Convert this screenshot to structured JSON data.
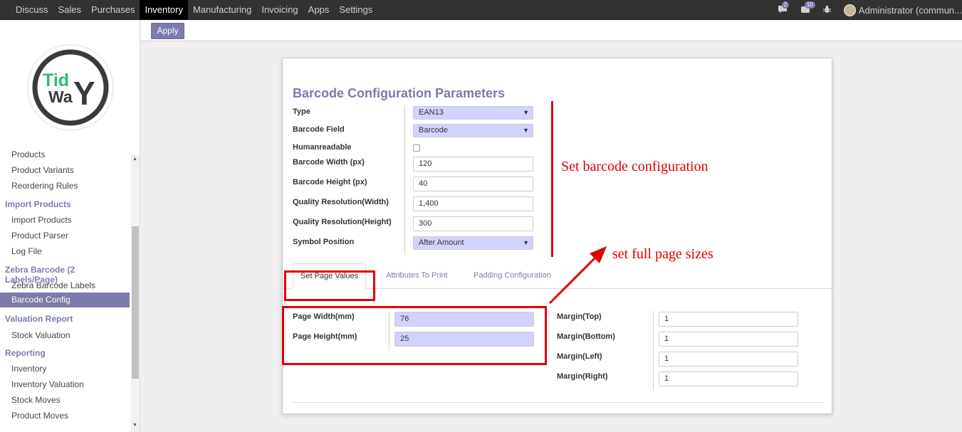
{
  "topbar": {
    "menu": [
      "Discuss",
      "Sales",
      "Purchases",
      "Inventory",
      "Manufacturing",
      "Invoicing",
      "Apps",
      "Settings"
    ],
    "active_index": 3,
    "chat_badge": "2",
    "activity_badge": "10",
    "user": "Administrator (commun..."
  },
  "control_panel": {
    "apply_label": "Apply"
  },
  "sidebar": {
    "logo_text_top": "Tid",
    "logo_text_bottom": "WaY",
    "items": [
      {
        "label": "Products",
        "type": "item"
      },
      {
        "label": "Product Variants",
        "type": "item"
      },
      {
        "label": "Reordering Rules",
        "type": "item"
      },
      {
        "label": "Import Products",
        "type": "head"
      },
      {
        "label": "Import Products",
        "type": "item"
      },
      {
        "label": "Product Parser",
        "type": "item"
      },
      {
        "label": "Log File",
        "type": "item"
      },
      {
        "label": "Zebra Barcode (2 Labels/Page)",
        "type": "head"
      },
      {
        "label": "Zebra Barcode Labels",
        "type": "item"
      },
      {
        "label": "Barcode Config",
        "type": "selected"
      },
      {
        "label": "Valuation Report",
        "type": "head"
      },
      {
        "label": "Stock Valuation",
        "type": "item"
      },
      {
        "label": "Reporting",
        "type": "head"
      },
      {
        "label": "Inventory",
        "type": "item"
      },
      {
        "label": "Inventory Valuation",
        "type": "item"
      },
      {
        "label": "Stock Moves",
        "type": "item"
      },
      {
        "label": "Product Moves",
        "type": "item"
      }
    ]
  },
  "form": {
    "title": "Barcode Configuration Parameters",
    "fields": {
      "type": {
        "label": "Type",
        "value": "EAN13"
      },
      "barcode_field": {
        "label": "Barcode Field",
        "value": "Barcode"
      },
      "humanreadable": {
        "label": "Humanreadable",
        "checked": false
      },
      "barcode_width": {
        "label": "Barcode Width (px)",
        "value": "120"
      },
      "barcode_height": {
        "label": "Barcode Height (px)",
        "value": "40"
      },
      "quality_width": {
        "label": "Quality Resolution(Width)",
        "value": "1,400"
      },
      "quality_height": {
        "label": "Quality Resolution(Height)",
        "value": "300"
      },
      "symbol_position": {
        "label": "Symbol Position",
        "value": "After Amount"
      }
    },
    "tabs": [
      "Set Page Values",
      "Attributes To Print",
      "Padding Configuration"
    ],
    "active_tab": 0,
    "page": {
      "page_width": {
        "label": "Page Width(mm)",
        "value": "76"
      },
      "page_height": {
        "label": "Page Height(mm)",
        "value": "25"
      },
      "margin_top": {
        "label": "Margin(Top)",
        "value": "1"
      },
      "margin_bottom": {
        "label": "Margin(Bottom)",
        "value": "1"
      },
      "margin_left": {
        "label": "Margin(Left)",
        "value": "1"
      },
      "margin_right": {
        "label": "Margin(Right)",
        "value": "1"
      }
    }
  },
  "annotations": {
    "config_note": "Set barcode configuration",
    "page_note": "set full page sizes",
    "color": "#e00000"
  },
  "colors": {
    "accent": "#7c7bad",
    "topbar": "#323232",
    "required_field": "#d2d2ff"
  }
}
